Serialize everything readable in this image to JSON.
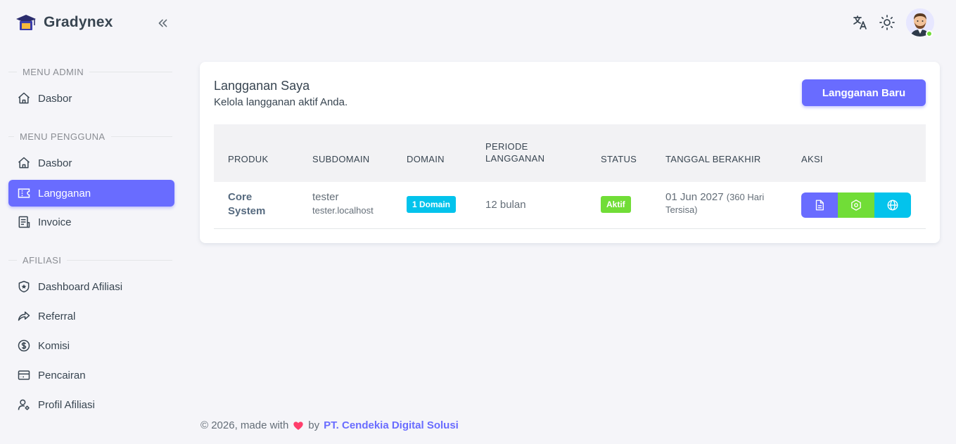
{
  "brand": {
    "name": "Gradynex"
  },
  "sidebar": {
    "sections": [
      {
        "header": "MENU ADMIN",
        "items": [
          {
            "label": "Dasbor",
            "icon": "home-icon"
          }
        ]
      },
      {
        "header": "MENU PENGGUNA",
        "items": [
          {
            "label": "Dasbor",
            "icon": "home-icon"
          },
          {
            "label": "Langganan",
            "icon": "ticket-icon",
            "active": true
          },
          {
            "label": "Invoice",
            "icon": "invoice-icon"
          }
        ]
      },
      {
        "header": "AFILIASI",
        "items": [
          {
            "label": "Dashboard Afiliasi",
            "icon": "shield-star-icon"
          },
          {
            "label": "Referral",
            "icon": "share-arrow-icon"
          },
          {
            "label": "Komisi",
            "icon": "dollar-circle-icon"
          },
          {
            "label": "Pencairan",
            "icon": "wallet-icon"
          },
          {
            "label": "Profil Afiliasi",
            "icon": "user-cog-icon"
          }
        ]
      }
    ]
  },
  "topbar": {
    "icons": [
      "translate-icon",
      "sun-icon",
      "avatar"
    ]
  },
  "card": {
    "title": "Langganan Saya",
    "subtitle": "Kelola langganan aktif Anda.",
    "new_button": "Langganan Baru",
    "columns": [
      "PRODUK",
      "SUBDOMAIN",
      "DOMAIN",
      "PERIODE LANGGANAN",
      "STATUS",
      "TANGGAL BERAKHIR",
      "AKSI"
    ],
    "rows": [
      {
        "product_line1": "Core",
        "product_line2": "System",
        "subdomain": "tester",
        "subdomain_host": "tester.localhost",
        "domain_badge": "1 Domain",
        "period": "12 bulan",
        "status": "Aktif",
        "end_date": "01 Jun 2027",
        "remaining_line1": "(360 Hari",
        "remaining_line2": "Tersisa)",
        "actions": [
          "document-icon",
          "settings-icon",
          "globe-icon"
        ]
      }
    ]
  },
  "footer": {
    "prefix": "© 2026, made with",
    "by": "by",
    "company": "PT. Cendekia Digital Solusi"
  },
  "colors": {
    "primary": "#696cff",
    "success": "#71dd37",
    "info": "#03c3ec",
    "background": "#f5f5f9"
  }
}
